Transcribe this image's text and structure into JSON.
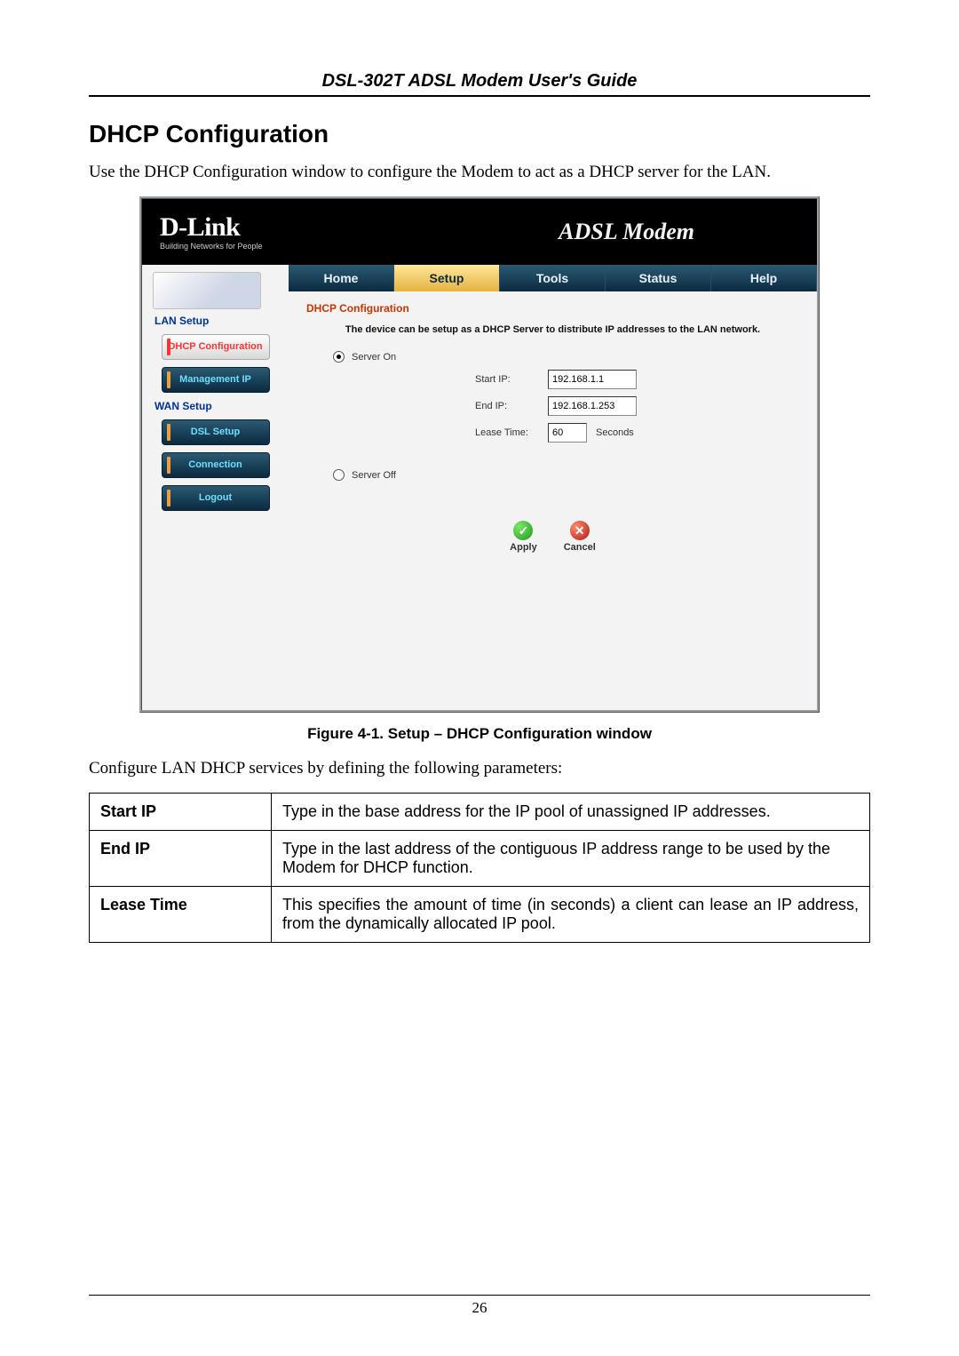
{
  "doc": {
    "header": "DSL-302T ADSL Modem User's Guide",
    "section_title": "DHCP Configuration",
    "intro": "Use the DHCP Configuration window to configure the Modem to act as a DHCP server for the LAN.",
    "figure_caption": "Figure 4-1. Setup – DHCP Configuration window",
    "configure_line": "Configure LAN DHCP services by defining the following parameters:",
    "page_number": "26"
  },
  "screenshot": {
    "logo_main": "D-Link",
    "logo_tag": "Building Networks for People",
    "product": "ADSL Modem",
    "tabs": [
      "Home",
      "Setup",
      "Tools",
      "Status",
      "Help"
    ],
    "active_tab_index": 1,
    "sidebar": {
      "cat1": "LAN Setup",
      "cat2": "WAN Setup",
      "buttons": {
        "dhcp": "DHCP Configuration",
        "mgmt": "Management IP",
        "dsl": "DSL Setup",
        "conn": "Connection",
        "logout": "Logout"
      }
    },
    "main": {
      "title": "DHCP Configuration",
      "desc": "The device can be setup as a DHCP Server to distribute IP addresses to the LAN network.",
      "server_on": "Server On",
      "server_off": "Server Off",
      "start_ip_label": "Start IP:",
      "start_ip_value": "192.168.1.1",
      "end_ip_label": "End IP:",
      "end_ip_value": "192.168.1.253",
      "lease_label": "Lease Time:",
      "lease_value": "60",
      "lease_unit": "Seconds",
      "apply": "Apply",
      "cancel": "Cancel"
    }
  },
  "table": {
    "rows": [
      {
        "param": "Start IP",
        "desc": "Type in the base address for the IP pool of unassigned IP addresses."
      },
      {
        "param": "End IP",
        "desc": "Type in the last address of the contiguous IP address range to be used by the Modem for DHCP function."
      },
      {
        "param": "Lease Time",
        "desc": "This specifies the amount of time (in seconds) a client can lease an IP address, from the dynamically allocated IP pool."
      }
    ]
  }
}
